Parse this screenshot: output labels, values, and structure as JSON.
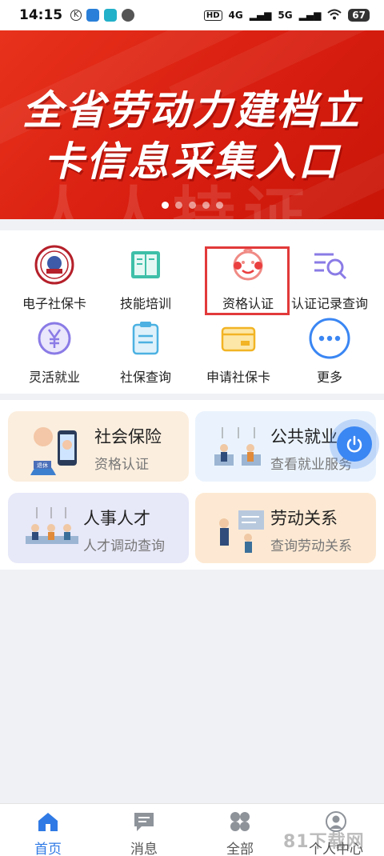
{
  "status_bar": {
    "time": "14:15",
    "network1": "4G",
    "network2": "5G",
    "battery": "67"
  },
  "banner": {
    "line1": "全省劳动力建档立",
    "line2": "卡信息采集入口",
    "watermark": "人人持证",
    "slide_count": 5,
    "active_slide": 0
  },
  "menu": {
    "items": [
      {
        "label": "电子社保卡",
        "icon": "social-security-card-icon"
      },
      {
        "label": "技能培训",
        "icon": "book-icon"
      },
      {
        "label": "资格认证",
        "icon": "face-icon"
      },
      {
        "label": "认证记录查询",
        "icon": "list-search-icon"
      },
      {
        "label": "灵活就业",
        "icon": "yen-icon"
      },
      {
        "label": "社保查询",
        "icon": "clipboard-icon"
      },
      {
        "label": "申请社保卡",
        "icon": "card-icon"
      },
      {
        "label": "更多",
        "icon": "more-icon"
      }
    ]
  },
  "cards": [
    {
      "title": "社会保险",
      "subtitle": "资格认证",
      "color": "#fbeede"
    },
    {
      "title": "公共就业",
      "subtitle": "查看就业服务",
      "color": "#eaf3fd"
    },
    {
      "title": "人事人才",
      "subtitle": "人才调动查询",
      "color": "#e7e8f8"
    },
    {
      "title": "劳动关系",
      "subtitle": "查询劳动关系",
      "color": "#fde9d3"
    }
  ],
  "tabs": [
    {
      "label": "首页",
      "icon": "home-icon",
      "active": true
    },
    {
      "label": "消息",
      "icon": "message-icon",
      "active": false
    },
    {
      "label": "全部",
      "icon": "grid-icon",
      "active": false
    },
    {
      "label": "个人中心",
      "icon": "person-icon",
      "active": false
    }
  ],
  "watermark_site": "81下载网",
  "colors": {
    "accent": "#2f7ae5",
    "banner_red": "#d81e10",
    "highlight": "#e23a3a"
  }
}
